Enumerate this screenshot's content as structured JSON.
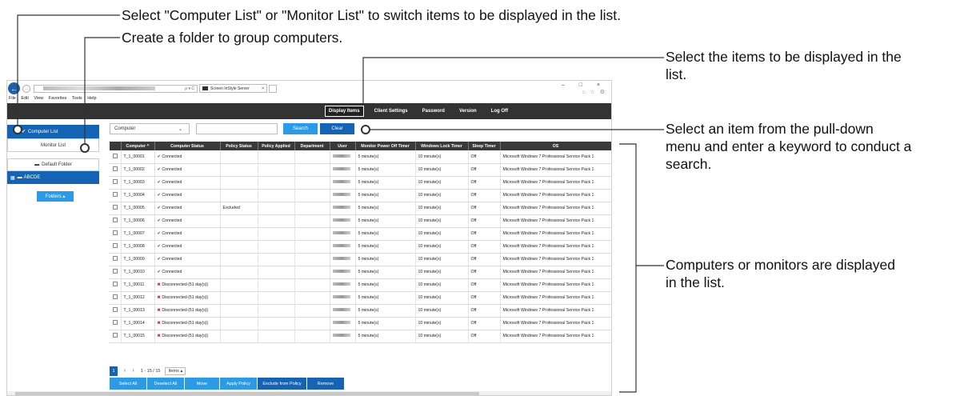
{
  "annotations": {
    "list_switch": "Select \"Computer List\" or \"Monitor List\" to switch items to be displayed in the list.",
    "folder": "Create a folder to group computers.",
    "display_items_1": "Select the items to be displayed in the",
    "display_items_2": "list.",
    "search_1": "Select an item from the pull-down",
    "search_2": "menu and enter a keyword to conduct a",
    "search_3": "search.",
    "list_1": "Computers or monitors are displayed",
    "list_2": "in the list."
  },
  "browser": {
    "tab_title": "Screen InStyle Server",
    "search_glyph": "ρ ▾ C",
    "menu": [
      "File",
      "Edit",
      "View",
      "Favorites",
      "Tools",
      "Help"
    ],
    "window_controls": "– □ ×",
    "toolbar_icons": "⌂ ☆ ⚙"
  },
  "nav": {
    "items": [
      "Display Items",
      "Client Settings",
      "Password",
      "Version",
      "Log Off"
    ]
  },
  "left_pane": {
    "computer_list": "Computer List",
    "monitor_list": "Monitor List",
    "default_folder": "Default Folder",
    "abcde_folder": "ABCDE",
    "folders_button": "Folders ▴"
  },
  "search": {
    "selected_option": "Computer",
    "search_label": "Search",
    "clear_label": "Clear"
  },
  "table": {
    "headers": [
      "",
      "Computer ^",
      "Computer Status",
      "Policy Status",
      "Policy Applied",
      "Department",
      "User",
      "Monitor Power Off Timer",
      "Windows Lock Timer",
      "Sleep Timer",
      "OS"
    ],
    "rows": [
      {
        "name": "T_1_00001",
        "status": "Connected",
        "policy": "",
        "power": "5 minute(s)",
        "lock": "10 minute(s)",
        "sleep": "Off",
        "os": "Microsoft Windows 7 Professional Service Pack 1"
      },
      {
        "name": "T_1_00002",
        "status": "Connected",
        "policy": "",
        "power": "5 minute(s)",
        "lock": "10 minute(s)",
        "sleep": "Off",
        "os": "Microsoft Windows 7 Professional Service Pack 1"
      },
      {
        "name": "T_1_00003",
        "status": "Connected",
        "policy": "",
        "power": "5 minute(s)",
        "lock": "10 minute(s)",
        "sleep": "Off",
        "os": "Microsoft Windows 7 Professional Service Pack 1"
      },
      {
        "name": "T_1_00004",
        "status": "Connected",
        "policy": "",
        "power": "5 minute(s)",
        "lock": "10 minute(s)",
        "sleep": "Off",
        "os": "Microsoft Windows 7 Professional Service Pack 1"
      },
      {
        "name": "T_1_00005",
        "status": "Connected",
        "policy": "Excluded",
        "power": "5 minute(s)",
        "lock": "10 minute(s)",
        "sleep": "Off",
        "os": "Microsoft Windows 7 Professional Service Pack 1"
      },
      {
        "name": "T_1_00006",
        "status": "Connected",
        "policy": "",
        "power": "5 minute(s)",
        "lock": "10 minute(s)",
        "sleep": "Off",
        "os": "Microsoft Windows 7 Professional Service Pack 1"
      },
      {
        "name": "T_1_00007",
        "status": "Connected",
        "policy": "",
        "power": "5 minute(s)",
        "lock": "10 minute(s)",
        "sleep": "Off",
        "os": "Microsoft Windows 7 Professional Service Pack 1"
      },
      {
        "name": "T_1_00008",
        "status": "Connected",
        "policy": "",
        "power": "5 minute(s)",
        "lock": "10 minute(s)",
        "sleep": "Off",
        "os": "Microsoft Windows 7 Professional Service Pack 1"
      },
      {
        "name": "T_1_00009",
        "status": "Connected",
        "policy": "",
        "power": "5 minute(s)",
        "lock": "10 minute(s)",
        "sleep": "Off",
        "os": "Microsoft Windows 7 Professional Service Pack 1"
      },
      {
        "name": "T_1_00010",
        "status": "Connected",
        "policy": "",
        "power": "5 minute(s)",
        "lock": "10 minute(s)",
        "sleep": "Off",
        "os": "Microsoft Windows 7 Professional Service Pack 1"
      },
      {
        "name": "T_1_00011",
        "status": "Disconnected (51 day(s))",
        "policy": "",
        "power": "5 minute(s)",
        "lock": "10 minute(s)",
        "sleep": "Off",
        "os": "Microsoft Windows 7 Professional Service Pack 1"
      },
      {
        "name": "T_1_00012",
        "status": "Disconnected (51 day(s))",
        "policy": "",
        "power": "5 minute(s)",
        "lock": "10 minute(s)",
        "sleep": "Off",
        "os": "Microsoft Windows 7 Professional Service Pack 1"
      },
      {
        "name": "T_1_00013",
        "status": "Disconnected (51 day(s))",
        "policy": "",
        "power": "5 minute(s)",
        "lock": "10 minute(s)",
        "sleep": "Off",
        "os": "Microsoft Windows 7 Professional Service Pack 1"
      },
      {
        "name": "T_1_00014",
        "status": "Disconnected (51 day(s))",
        "policy": "",
        "power": "5 minute(s)",
        "lock": "10 minute(s)",
        "sleep": "Off",
        "os": "Microsoft Windows 7 Professional Service Pack 1"
      },
      {
        "name": "T_1_00015",
        "status": "Disconnected (51 day(s))",
        "policy": "",
        "power": "5 minute(s)",
        "lock": "10 minute(s)",
        "sleep": "Off",
        "os": "Microsoft Windows 7 Professional Service Pack 1"
      }
    ]
  },
  "pager": {
    "page": "1",
    "range": "1 - 15 / 15",
    "items_label": "Items ▴"
  },
  "actions": [
    "Select All",
    "Deselect All",
    "Move",
    "Apply Policy",
    "Exclude from Policy",
    "Remove"
  ],
  "colors": {
    "primary_dark": "#1564b4",
    "primary_light": "#2b9be8",
    "connected": "#2a9a2a",
    "disconnected": "#dd2222"
  }
}
